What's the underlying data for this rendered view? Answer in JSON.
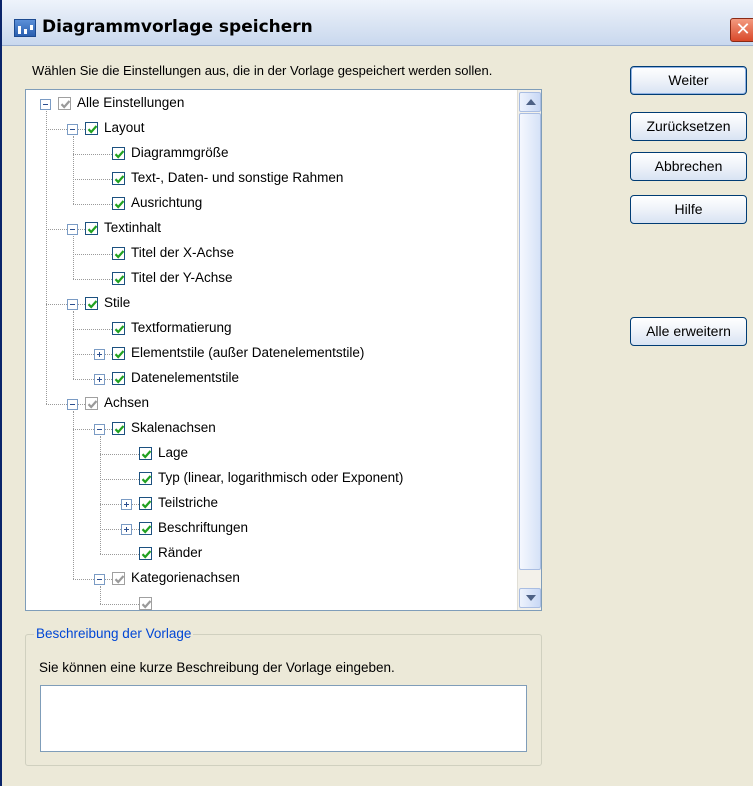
{
  "window": {
    "title": "Diagrammvorlage speichern",
    "close_glyph": "✕",
    "title_icon": "chart-icon"
  },
  "instruction": "Wählen Sie die Einstellungen aus, die in der Vorlage gespeichert werden sollen.",
  "tree": {
    "items": [
      {
        "label": "Alle Einstellungen",
        "level": 0,
        "expander": "minus",
        "checked": true,
        "greyed": true
      },
      {
        "label": "Layout",
        "level": 1,
        "expander": "minus",
        "checked": true,
        "greyed": false
      },
      {
        "label": "Diagrammgröße",
        "level": 2,
        "expander": "none",
        "checked": true,
        "greyed": false
      },
      {
        "label": "Text-, Daten- und sonstige Rahmen",
        "level": 2,
        "expander": "none",
        "checked": true,
        "greyed": false
      },
      {
        "label": "Ausrichtung",
        "level": 2,
        "expander": "none",
        "checked": true,
        "greyed": false
      },
      {
        "label": "Textinhalt",
        "level": 1,
        "expander": "minus",
        "checked": true,
        "greyed": false
      },
      {
        "label": "Titel der X-Achse",
        "level": 2,
        "expander": "none",
        "checked": true,
        "greyed": false
      },
      {
        "label": "Titel der Y-Achse",
        "level": 2,
        "expander": "none",
        "checked": true,
        "greyed": false
      },
      {
        "label": "Stile",
        "level": 1,
        "expander": "minus",
        "checked": true,
        "greyed": false
      },
      {
        "label": "Textformatierung",
        "level": 2,
        "expander": "none",
        "checked": true,
        "greyed": false
      },
      {
        "label": "Elementstile (außer Datenelementstile)",
        "level": 2,
        "expander": "plus",
        "checked": true,
        "greyed": false
      },
      {
        "label": "Datenelementstile",
        "level": 2,
        "expander": "plus",
        "checked": true,
        "greyed": false
      },
      {
        "label": "Achsen",
        "level": 1,
        "expander": "minus",
        "checked": true,
        "greyed": true
      },
      {
        "label": "Skalenachsen",
        "level": 2,
        "expander": "minus",
        "checked": true,
        "greyed": false
      },
      {
        "label": "Lage",
        "level": 3,
        "expander": "none",
        "checked": true,
        "greyed": false
      },
      {
        "label": "Typ (linear, logarithmisch oder Exponent)",
        "level": 3,
        "expander": "none",
        "checked": true,
        "greyed": false
      },
      {
        "label": "Teilstriche",
        "level": 3,
        "expander": "plus",
        "checked": true,
        "greyed": false
      },
      {
        "label": "Beschriftungen",
        "level": 3,
        "expander": "plus",
        "checked": true,
        "greyed": false
      },
      {
        "label": "Ränder",
        "level": 3,
        "expander": "none",
        "checked": true,
        "greyed": false
      },
      {
        "label": "Kategorienachsen",
        "level": 2,
        "expander": "minus",
        "checked": true,
        "greyed": true
      },
      {
        "label": "",
        "level": 3,
        "expander": "none",
        "checked": true,
        "greyed": true
      }
    ]
  },
  "buttons": {
    "weiter": "Weiter",
    "zuruecksetzen": "Zurücksetzen",
    "abbrechen": "Abbrechen",
    "hilfe": "Hilfe",
    "alle_erweitern": "Alle erweitern"
  },
  "description": {
    "legend": "Beschreibung der Vorlage",
    "hint": "Sie können eine kurze Beschreibung der Vorlage eingeben.",
    "value": ""
  }
}
